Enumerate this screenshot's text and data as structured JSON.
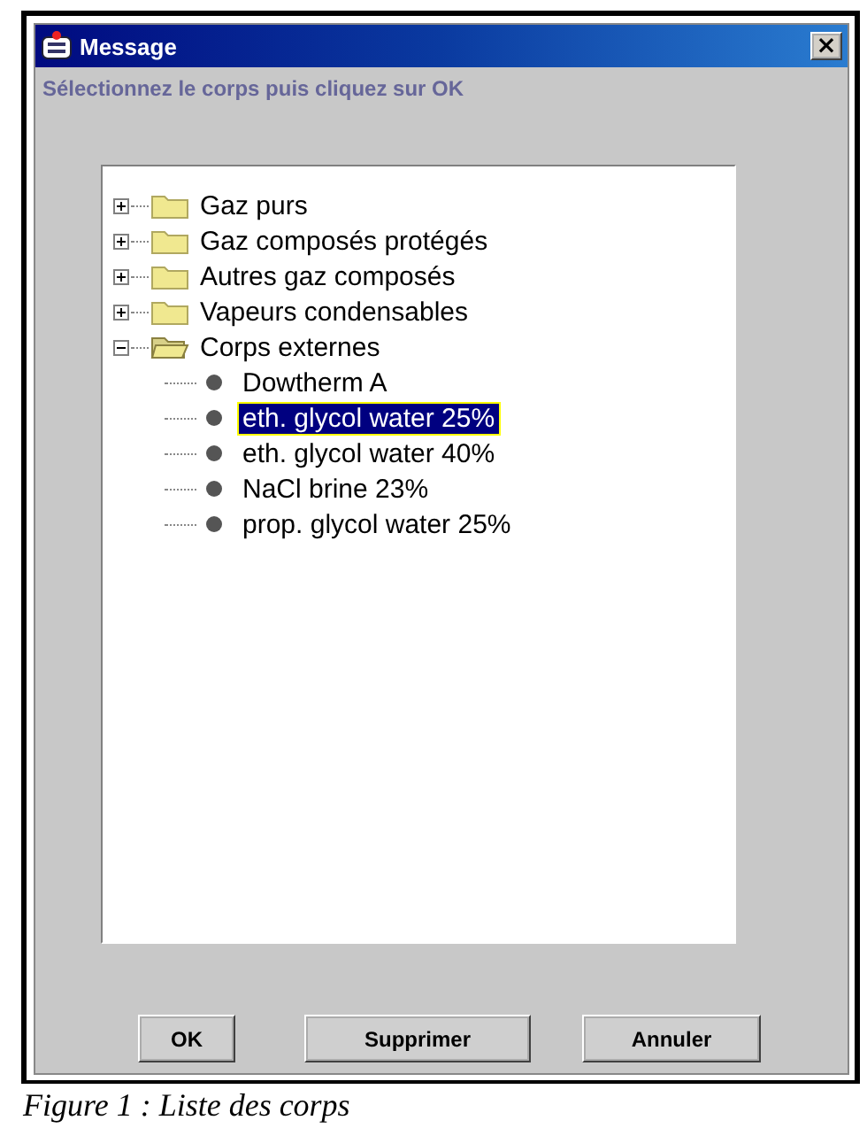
{
  "window": {
    "title": "Message",
    "close": "×"
  },
  "prompt": "Sélectionnez le corps puis cliquez sur OK",
  "tree": [
    {
      "label": "Gaz purs",
      "expanded": false
    },
    {
      "label": "Gaz composés protégés",
      "expanded": false
    },
    {
      "label": "Autres gaz composés",
      "expanded": false
    },
    {
      "label": "Vapeurs condensables",
      "expanded": false
    },
    {
      "label": "Corps externes",
      "expanded": true,
      "children": [
        {
          "label": "Dowtherm A",
          "selected": false
        },
        {
          "label": "eth. glycol water 25%",
          "selected": true
        },
        {
          "label": "eth. glycol water 40%",
          "selected": false
        },
        {
          "label": "NaCl brine 23%",
          "selected": false
        },
        {
          "label": "prop. glycol water 25%",
          "selected": false
        }
      ]
    }
  ],
  "buttons": [
    "OK",
    "Supprimer",
    "Annuler"
  ],
  "caption": "Figure 1 : Liste des corps"
}
